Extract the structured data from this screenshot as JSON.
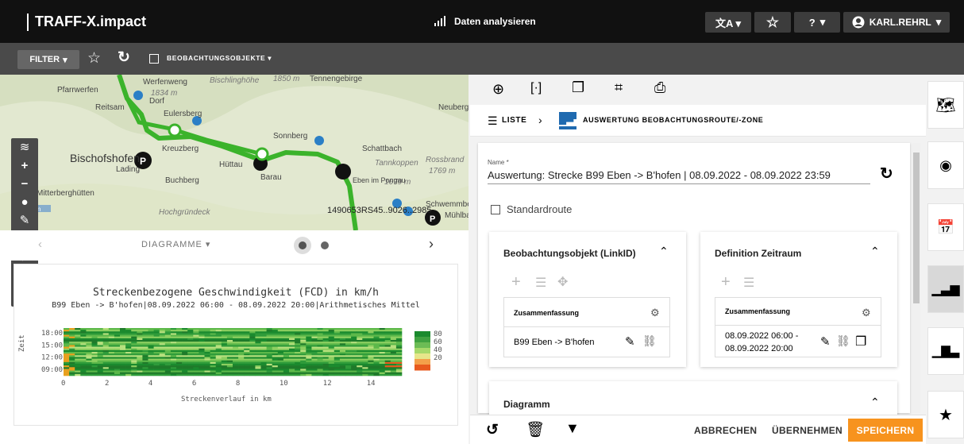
{
  "header": {
    "app_title": "TRAFF-X.impact",
    "center_label": "Daten analysieren",
    "user": "KARL.REHRL",
    "help": "?"
  },
  "toolbar": {
    "filter_label": "FILTER",
    "objects_label": "BEOBACHTUNGSOBJEKTE"
  },
  "map": {
    "places": [
      "Pfarrwerfen",
      "Werfenweng",
      "Bischlinghöhe",
      "1850 m",
      "Tennengebirge",
      "1834 m",
      "Dorf",
      "Reitsam",
      "Eulersberg",
      "Neuberg",
      "Sonnberg",
      "Schattbach",
      "Kreuzberg",
      "Bischofshofen",
      "Hüttau",
      "Rossbrand",
      "1769 m",
      "Tannkoppen",
      "1679 m",
      "Buchberg",
      "Barau",
      "Eben im Pongau",
      "Mitterberghütten",
      "Hochgründeck",
      "Schwemmberg",
      "Mühlbach",
      "Lading"
    ],
    "scale": "5 km",
    "overlay_text": "1490653RS45..9026..2985"
  },
  "diagram": {
    "header_label": "DIAGRAMME",
    "title": "Streckenbezogene Geschwindigkeit (FCD) in km/h",
    "subtitle": "B99 Eben -> B'hofen|08.09.2022 06:00 - 08.09.2022 20:00|Arithmetisches Mittel"
  },
  "chart_data": {
    "type": "heatmap",
    "title": "Streckenbezogene Geschwindigkeit (FCD) in km/h",
    "subtitle": "B99 Eben -> B'hofen|08.09.2022 06:00 - 08.09.2022 20:00|Arithmetisches Mittel",
    "xlabel": "Streckenverlauf in km",
    "ylabel": "Zeit",
    "xticks": [
      "0",
      "2",
      "4",
      "6",
      "8",
      "10",
      "12",
      "14"
    ],
    "yticks": [
      "18:00",
      "15:00",
      "12:00",
      "09:00"
    ],
    "colorbar_ticks": [
      "80",
      "60",
      "40",
      "20"
    ],
    "xlim": [
      0,
      15.5
    ],
    "ylim": [
      "06:00",
      "20:00"
    ],
    "colors": {
      "high": "#1a8a2e",
      "mid": "#9bcf63",
      "low": "#e85a1e"
    }
  },
  "right_tools": [
    "zoom-in-icon",
    "focus-icon",
    "copy-icon",
    "crop-icon",
    "print-icon"
  ],
  "breadcrumb": {
    "list": "LISTE",
    "current": "AUSWERTUNG BEOBACHTUNGSROUTE/-ZONE"
  },
  "form": {
    "name_label": "Name *",
    "name_value": "Auswertung: Strecke B99 Eben -> B'hofen | 08.09.2022 - 08.09.2022 23:59",
    "standard_route": "Standardroute",
    "obj_card": {
      "title": "Beobachtungsobjekt (LinkID)",
      "summary_label": "Zusammenfassung",
      "value": "B99 Eben -> B'hofen"
    },
    "time_card": {
      "title": "Definition Zeitraum",
      "summary_label": "Zusammenfassung",
      "value_line1": "08.09.2022 06:00 -",
      "value_line2": "08.09.2022 20:00"
    },
    "diagram_card": {
      "title": "Diagramm"
    }
  },
  "bottom": {
    "cancel": "ABBRECHEN",
    "apply": "ÜBERNEHMEN",
    "save": "SPEICHERN",
    "save_color": "#f7931e"
  }
}
